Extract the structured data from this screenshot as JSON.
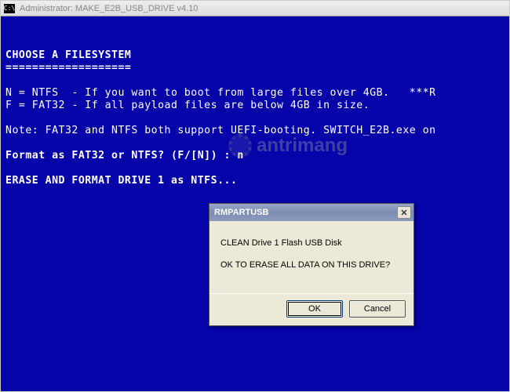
{
  "window": {
    "title": "Administrator:  MAKE_E2B_USB_DRIVE v4.10",
    "cmd_glyph": "C:\\"
  },
  "console": {
    "heading": "CHOOSE A FILESYSTEM",
    "heading_ul": "===================",
    "line_n": "N = NTFS  - If you want to boot from large files over 4GB.   ***R",
    "line_f": "F = FAT32 - If all payload files are below 4GB in size.",
    "note": "Note: FAT32 and NTFS both support UEFI-booting. SWITCH_E2B.exe on",
    "prompt": "Format as FAT32 or NTFS? (F/[N]) : n",
    "erase": "ERASE AND FORMAT DRIVE 1 as NTFS..."
  },
  "dialog": {
    "title": "RMPARTUSB",
    "line1": "CLEAN Drive 1  Flash USB Disk",
    "line2": "OK TO ERASE ALL DATA ON THIS DRIVE?",
    "ok_label": "OK",
    "cancel_label": "Cancel",
    "close_glyph": "✕"
  },
  "watermark": {
    "text": "antrimang"
  }
}
